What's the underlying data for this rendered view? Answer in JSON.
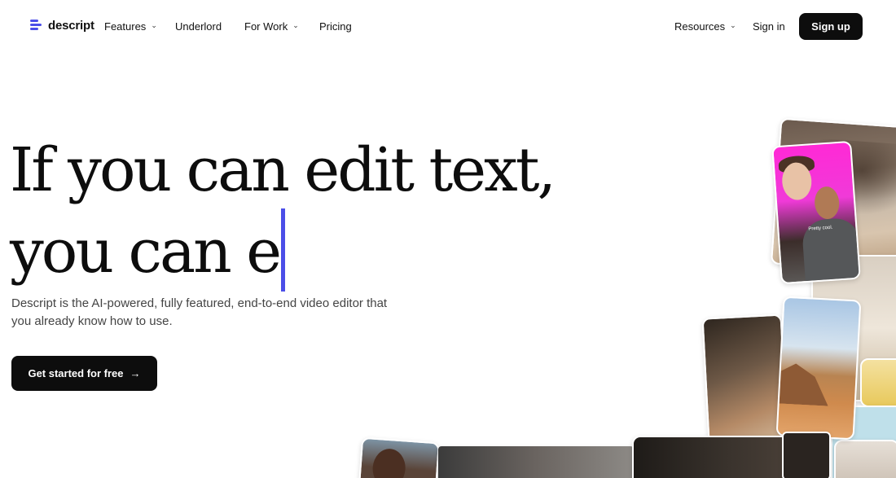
{
  "nav": {
    "logo": "descript",
    "items": [
      {
        "label": "Features",
        "dropdown": true
      },
      {
        "label": "Underlord",
        "dropdown": false
      },
      {
        "label": "For Work",
        "dropdown": true
      },
      {
        "label": "Pricing",
        "dropdown": false
      }
    ],
    "resources": "Resources",
    "sign_in": "Sign in",
    "sign_up": "Sign up"
  },
  "hero": {
    "headline_line1": "If you can edit text,",
    "headline_line2": "you can e",
    "subtitle": "Descript is the AI-powered, fully featured, end-to-end video editor that you already know how to use.",
    "cta": "Get started for free",
    "cta_icon": "→"
  },
  "collage": {
    "caption": "Pretty cool."
  },
  "colors": {
    "accent": "#4b4ee8",
    "button_bg": "#0d0d0d",
    "text": "#111111"
  }
}
